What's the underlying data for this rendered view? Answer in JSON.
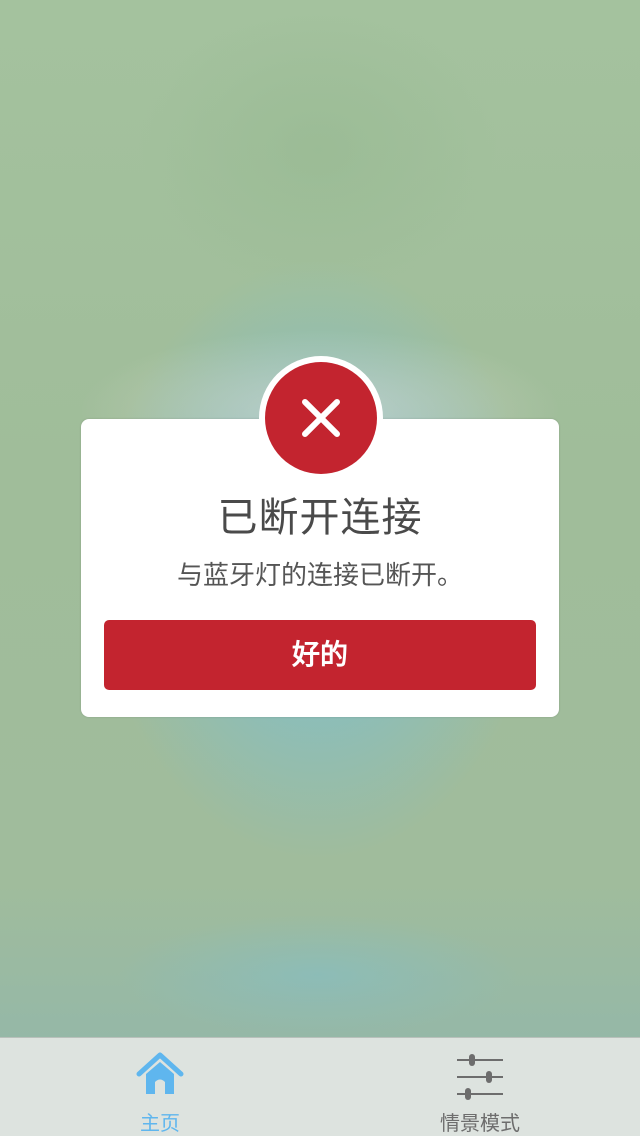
{
  "dialog": {
    "title": "已断开连接",
    "message": "与蓝牙灯的连接已断开。",
    "ok_label": "好的",
    "icon": "close-icon",
    "accent_color": "#c3242f"
  },
  "tabbar": {
    "tabs": [
      {
        "label": "主页",
        "icon": "home-icon",
        "active": true,
        "color": "#5fb6ee"
      },
      {
        "label": "情景模式",
        "icon": "sliders-icon",
        "active": false,
        "color": "#6d6d6d"
      }
    ]
  }
}
